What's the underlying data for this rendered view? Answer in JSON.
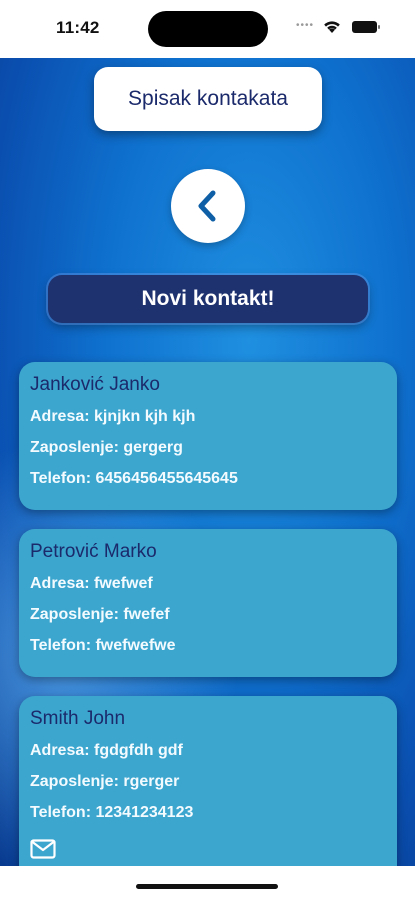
{
  "status_bar": {
    "time": "11:42"
  },
  "header": {
    "title": "Spisak kontakata"
  },
  "actions": {
    "new_contact_label": "Novi kontakt!"
  },
  "contacts": [
    {
      "name": "Janković Janko",
      "address": "Adresa: kjnjkn kjh kjh",
      "job": "Zaposlenje: gergerg",
      "phone": "Telefon: 6456456455645645"
    },
    {
      "name": "Petrović Marko",
      "address": "Adresa: fwefwef",
      "job": "Zaposlenje: fwefef",
      "phone": "Telefon: fwefwefwe"
    },
    {
      "name": "Smith John",
      "address": "Adresa: fgdgfdh gdf",
      "job": "Zaposlenje: rgerger",
      "phone": "Telefon: 12341234123"
    }
  ],
  "icons": {
    "back": "chevron-left-icon",
    "mail": "mail-icon",
    "wifi": "wifi-icon",
    "battery": "battery-icon"
  },
  "colors": {
    "accent_dark": "#1e3270",
    "card": "#3ca6cf",
    "text_dark": "#1b2a6b"
  }
}
